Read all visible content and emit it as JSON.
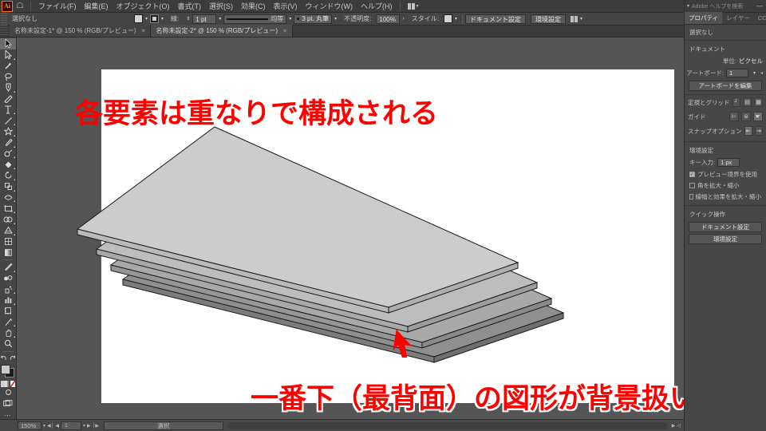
{
  "app": {
    "logo_text": "Ai",
    "home_icon": "home-icon"
  },
  "menubar": {
    "items": [
      {
        "label": "ファイル(F)"
      },
      {
        "label": "編集(E)"
      },
      {
        "label": "オブジェクト(O)"
      },
      {
        "label": "書式(T)"
      },
      {
        "label": "選択(S)"
      },
      {
        "label": "効果(C)"
      },
      {
        "label": "表示(V)"
      },
      {
        "label": "ウィンドウ(W)"
      },
      {
        "label": "ヘルプ(H)"
      }
    ],
    "arrange_caret": "▾",
    "search_placeholder": "Adobe ヘルプを検索",
    "minimize": "—"
  },
  "controlbar": {
    "selection_status": "選択なし",
    "fill_label": "fill-swatch",
    "stroke_label": "stroke-swatch",
    "stroke_weight_label": "線:",
    "stroke_weight_value": "1 pt",
    "stroke_profile_label": "均等",
    "brush_value": "3 pt. 丸筆",
    "opacity_label": "不透明度:",
    "opacity_value": "100%",
    "opacity_arrow": "›",
    "style_label": "スタイル:",
    "doc_setup_button": "ドキュメント設定",
    "preferences_button": "環境設定",
    "caret": "▾"
  },
  "tabs": [
    {
      "label": "名称未設定-1* @ 150 % (RGB/プレビュー)",
      "close": "✕",
      "active": false
    },
    {
      "label": "名称未設定-2* @ 150 % (RGB/プレビュー)",
      "close": "✕",
      "active": true
    }
  ],
  "toolbar": {
    "tools": [
      {
        "name": "selection-tool",
        "glyph": "▶",
        "selected": true
      },
      {
        "name": "direct-selection-tool",
        "glyph": "▷",
        "selected": false
      },
      {
        "name": "magic-wand-tool",
        "glyph": "✦",
        "selected": false
      },
      {
        "name": "lasso-tool",
        "glyph": "◌",
        "selected": false
      },
      {
        "name": "pen-tool",
        "glyph": "✒",
        "selected": false
      },
      {
        "name": "curvature-tool",
        "glyph": "✎",
        "selected": false
      },
      {
        "name": "type-tool",
        "glyph": "T",
        "selected": false
      },
      {
        "name": "line-segment-tool",
        "glyph": "╱",
        "selected": false
      },
      {
        "name": "shape-tool",
        "glyph": "☆",
        "selected": false
      },
      {
        "name": "paintbrush-tool",
        "glyph": "✐",
        "selected": false
      },
      {
        "name": "shaper-tool",
        "glyph": "◔",
        "selected": false
      },
      {
        "name": "eraser-tool",
        "glyph": "◆",
        "selected": false
      },
      {
        "name": "rotate-tool",
        "glyph": "↺",
        "selected": false
      },
      {
        "name": "scale-tool",
        "glyph": "⤡",
        "selected": false
      },
      {
        "name": "width-tool",
        "glyph": "⧓",
        "selected": false
      },
      {
        "name": "free-transform-tool",
        "glyph": "▣",
        "selected": false
      },
      {
        "name": "shape-builder-tool",
        "glyph": "⊚",
        "selected": false
      },
      {
        "name": "perspective-grid-tool",
        "glyph": "▦",
        "selected": false
      },
      {
        "name": "mesh-tool",
        "glyph": "▤",
        "selected": false
      },
      {
        "name": "gradient-tool",
        "glyph": "▧",
        "selected": false
      },
      {
        "name": "eyedropper-tool",
        "glyph": "⚗",
        "selected": false
      },
      {
        "name": "blend-tool",
        "glyph": "◑",
        "selected": false
      },
      {
        "name": "symbol-sprayer-tool",
        "glyph": "❁",
        "selected": false
      },
      {
        "name": "column-graph-tool",
        "glyph": "ᵟ",
        "selected": false
      },
      {
        "name": "artboard-tool",
        "glyph": "⬚",
        "selected": false
      },
      {
        "name": "slice-tool",
        "glyph": "✂",
        "selected": false
      },
      {
        "name": "hand-tool",
        "glyph": "✋",
        "selected": false
      },
      {
        "name": "zoom-tool",
        "glyph": "⚲",
        "selected": false
      }
    ],
    "undo_glyph": "↶",
    "redo_glyph": "↷",
    "color_modes": [
      "color-swatch",
      "gradient-swatch",
      "none-swatch"
    ],
    "screen_mode_glyph": "◱",
    "more_tools": "⋯"
  },
  "canvas": {
    "top_text": "各要素は重なりで構成される",
    "bottom_text": "一番下（最背面）の図形が背景扱い",
    "text_color": "#ff0000",
    "outline_color": "#ffffff",
    "artboard_bg": "#ffffff",
    "pasteboard_bg": "#555555",
    "layers": [
      {
        "name": "sheet-top",
        "fill": "#cccccc"
      },
      {
        "name": "sheet-second",
        "fill": "#bdbdbd"
      },
      {
        "name": "sheet-third",
        "fill": "#a9a9a9"
      },
      {
        "name": "sheet-bottom",
        "fill": "#8f8f8f"
      }
    ],
    "arrow": {
      "name": "red-pointer-arrow",
      "color": "#ff0000"
    }
  },
  "rightpanel": {
    "search_placeholder": "Adobe ヘルプを検索",
    "minimize": "—",
    "tabs": [
      {
        "label": "プロパティ",
        "active": true
      },
      {
        "label": "レイヤー",
        "active": false
      },
      {
        "label": "CC ライブラリ",
        "active": false
      }
    ],
    "status": "選択なし",
    "document_section": {
      "title": "ドキュメント",
      "unit_label": "単位:",
      "unit_value": "ピクセル",
      "artboard_label": "アートボード:",
      "artboard_value": "1",
      "artboard_edit_button": "アートボードを編集"
    },
    "rulers_section": {
      "rulers_label": "定規とグリッド",
      "guides_label": "ガイド",
      "snap_label": "スナップオプション"
    },
    "preferences_section": {
      "title": "環境設定",
      "key_input_label": "キー入力:",
      "key_input_value": "1 px",
      "checkboxes": [
        {
          "label": "プレビュー境界を使用",
          "checked": true
        },
        {
          "label": "角を拡大・縮小",
          "checked": false
        },
        {
          "label": "線幅と効果を拡大・縮小",
          "checked": false
        }
      ]
    },
    "quick_actions": {
      "title": "クイック操作",
      "buttons": [
        "ドキュメント設定",
        "環境設定"
      ]
    }
  },
  "statusbar": {
    "zoom_value": "150%",
    "zoom_caret": "▾",
    "nav_first": "◀│",
    "nav_prev": "◀",
    "page_value": "1",
    "page_caret": "▾",
    "nav_next": "▶",
    "nav_last": "│▶",
    "selection_tool_label": "選択",
    "right_arrow": "▶",
    "right_caret": "◁"
  }
}
